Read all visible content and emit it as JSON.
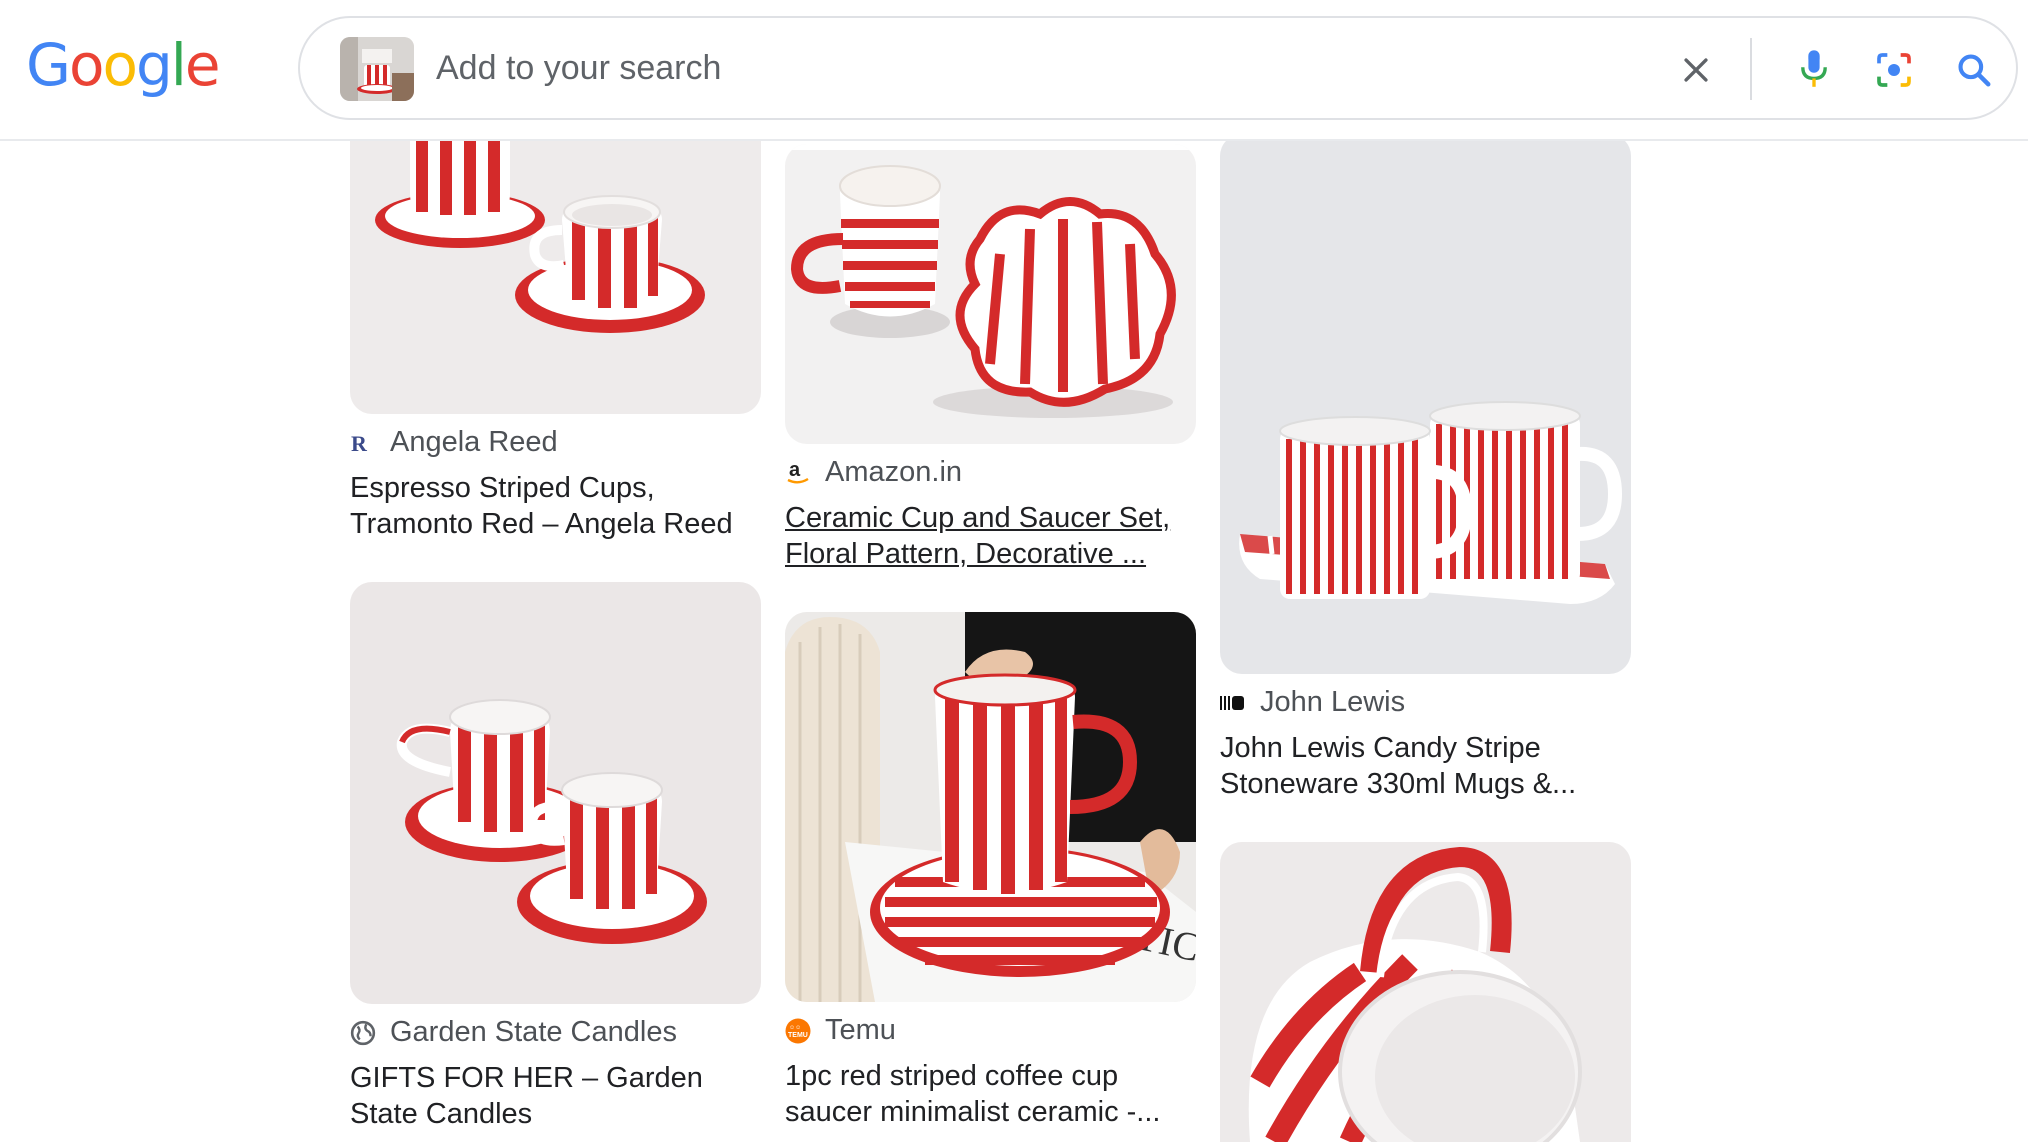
{
  "header": {
    "logo_letters": [
      {
        "ch": "G",
        "color": "#4285F4"
      },
      {
        "ch": "o",
        "color": "#EA4335"
      },
      {
        "ch": "o",
        "color": "#FBBC05"
      },
      {
        "ch": "g",
        "color": "#4285F4"
      },
      {
        "ch": "l",
        "color": "#34A853"
      },
      {
        "ch": "e",
        "color": "#EA4335"
      }
    ],
    "search_placeholder": "Add to your search",
    "search_value": "",
    "icons": [
      "clear-icon",
      "microphone-icon",
      "lens-camera-icon",
      "search-icon"
    ]
  },
  "results": [
    {
      "source": "Angela Reed",
      "title": "Espresso Striped Cups, Tramonto Red – Angela Reed",
      "favicon": "angela-reed-logo-icon",
      "underlined": false
    },
    {
      "source": "Garden State Candles",
      "title": "GIFTS FOR HER – Garden State Candles",
      "favicon": "globe-icon",
      "underlined": false
    },
    {
      "source": "Amazon.in",
      "title": "Ceramic Cup and Saucer Set, Floral Pattern, Decorative ...",
      "favicon": "amazon-logo-icon",
      "underlined": true
    },
    {
      "source": "Temu",
      "title": "1pc red striped coffee cup saucer minimalist ceramic -...",
      "favicon": "temu-logo-icon",
      "underlined": false
    },
    {
      "source": "John Lewis",
      "title": "John Lewis Candy Stripe Stoneware 330ml Mugs &...",
      "favicon": "john-lewis-logo-icon",
      "underlined": false
    },
    {
      "source": "",
      "title": "",
      "favicon": "",
      "underlined": false
    }
  ],
  "colors": {
    "stripe_red": "#D42A2A",
    "card_bg": "#EEEBEB",
    "text_primary": "#202124",
    "text_secondary": "#4d5156"
  }
}
